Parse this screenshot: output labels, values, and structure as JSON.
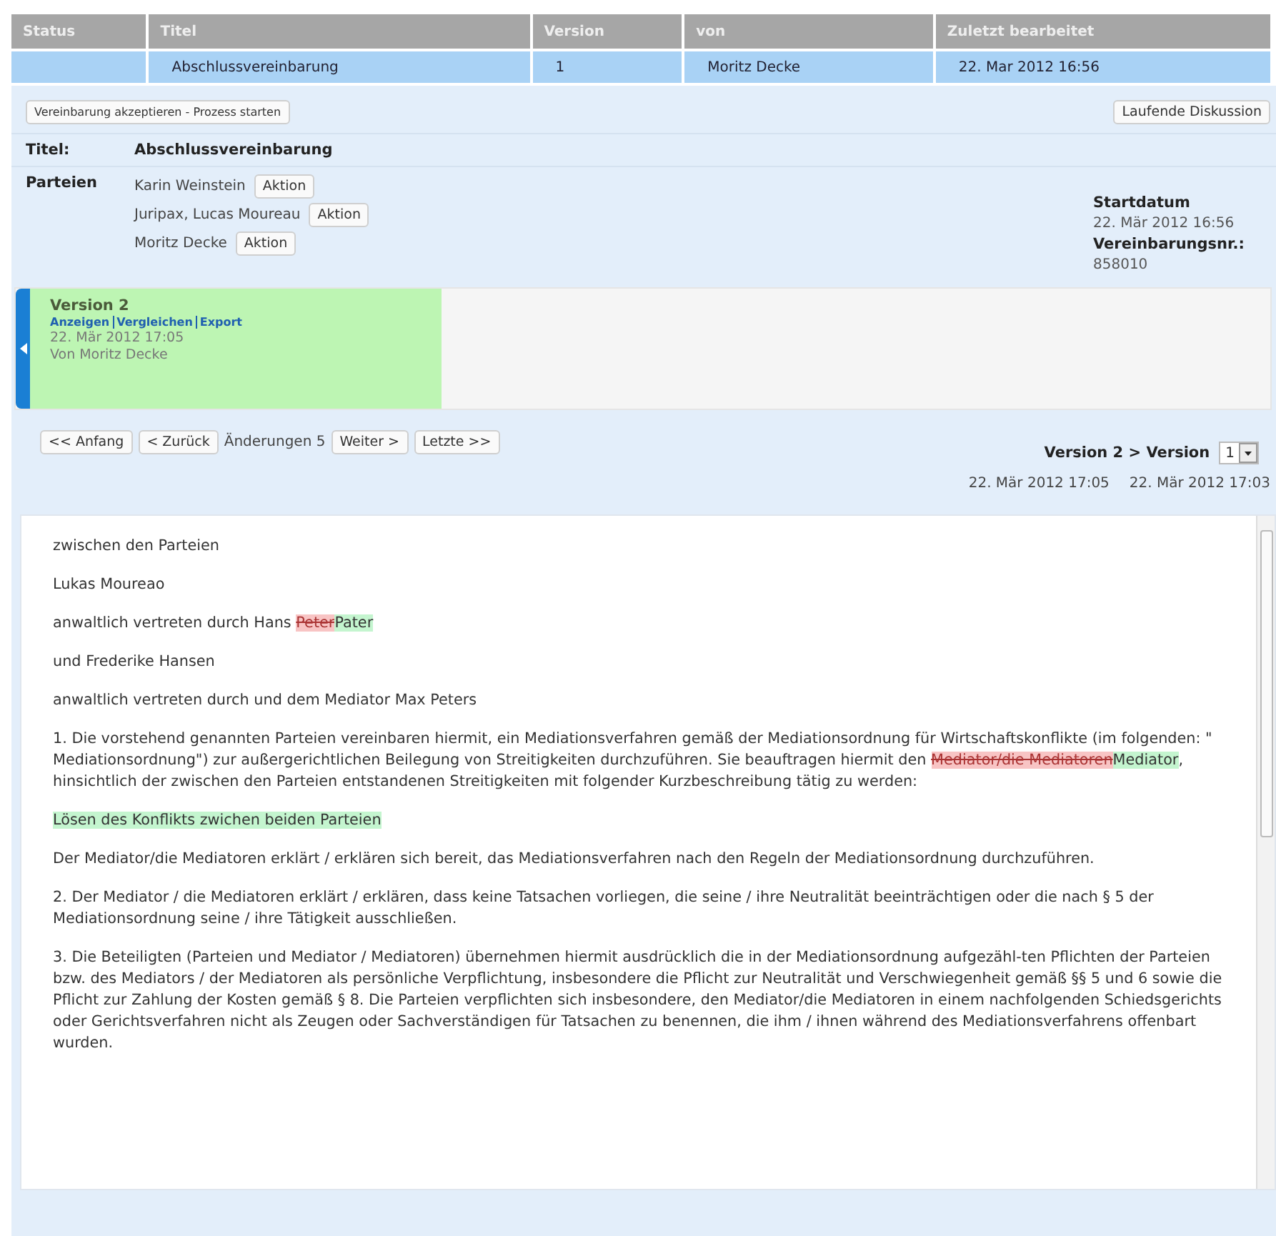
{
  "table": {
    "columns": [
      "Status",
      "Titel",
      "Version",
      "von",
      "Zuletzt bearbeitet"
    ],
    "rows": [
      {
        "selected": true,
        "cells": [
          "",
          "Abschlussvereinbarung",
          "1",
          "Moritz Decke",
          "22. Mar 2012 16:56"
        ]
      }
    ]
  },
  "actions": {
    "accept": "Vereinbarung akzeptieren - Prozess starten",
    "discussion": "Laufende Diskussion"
  },
  "title": {
    "label": "Titel:",
    "value": "Abschlussvereinbarung"
  },
  "parties": {
    "label": "Parteien",
    "items": [
      {
        "name": "Karin Weinstein",
        "action": "Aktion"
      },
      {
        "name": "Juripax, Lucas Moureau",
        "action": "Aktion"
      },
      {
        "name": "Moritz Decke",
        "action": "Aktion"
      }
    ]
  },
  "info": [
    {
      "label": "Startdatum",
      "value": "22. Mär 2012 16:56"
    },
    {
      "label": "Vereinbarungsnr.:",
      "value": "858010"
    }
  ],
  "version_card": {
    "title": "Version 2",
    "links": [
      "Anzeigen",
      "Vergleichen",
      "Export"
    ],
    "date": "22. Mär 2012 17:05",
    "author": "Von Moritz Decke"
  },
  "nav": {
    "first": "<< Anfang",
    "prev": "< Zurück",
    "changes": "Änderungen 5",
    "next": "Weiter >",
    "last": "Letzte >>"
  },
  "compare": {
    "label": "Version 2 > Version",
    "selected": "1",
    "dates": [
      "22. Mär 2012 17:05",
      "22. Mär 2012 17:03"
    ]
  },
  "document": [
    {
      "segments": [
        {
          "kind": "text",
          "text": "zwischen den Parteien"
        }
      ]
    },
    {
      "segments": [
        {
          "kind": "text",
          "text": "Lukas Moureao"
        }
      ]
    },
    {
      "segments": [
        {
          "kind": "text",
          "text": "anwaltlich vertreten durch Hans "
        },
        {
          "kind": "deleted",
          "text": "Peter"
        },
        {
          "kind": "inserted",
          "text": "Pater"
        }
      ]
    },
    {
      "segments": [
        {
          "kind": "text",
          "text": "und Frederike Hansen"
        }
      ]
    },
    {
      "segments": [
        {
          "kind": "text",
          "text": "anwaltlich vertreten durch und dem Mediator Max Peters"
        }
      ]
    },
    {
      "segments": [
        {
          "kind": "text",
          "text": "1. Die vorstehend genannten Parteien vereinbaren hiermit, ein Mediationsverfahren gemäß der Mediationsordnung für Wirtschaftskonflikte (im folgenden: \" Mediationsordnung\") zur außergerichtlichen Beilegung von Streitigkeiten durchzuführen. Sie beauftragen hiermit den "
        },
        {
          "kind": "deleted",
          "text": "Mediator/die Mediatoren"
        },
        {
          "kind": "inserted",
          "text": "Mediator"
        },
        {
          "kind": "text",
          "text": ", hinsichtlich der zwischen den Parteien entstandenen Streitigkeiten mit folgender Kurzbeschreibung tätig zu werden:"
        }
      ]
    },
    {
      "segments": [
        {
          "kind": "inserted",
          "text": "Lösen des Konflikts zwichen beiden Parteien"
        }
      ]
    },
    {
      "segments": [
        {
          "kind": "text",
          "text": "Der Mediator/die Mediatoren erklärt / erklären sich bereit, das Mediationsverfahren nach den Regeln der Mediationsordnung durchzuführen."
        }
      ]
    },
    {
      "segments": [
        {
          "kind": "text",
          "text": "2. Der Mediator / die Mediatoren erklärt / erklären, dass keine Tatsachen vorliegen, die seine / ihre Neutralität beeinträchtigen oder die nach § 5 der  Mediationsordnung seine / ihre Tätigkeit ausschließen."
        }
      ]
    },
    {
      "segments": [
        {
          "kind": "text",
          "text": "3. Die Beteiligten (Parteien und Mediator / Mediatoren) übernehmen hiermit ausdrücklich die in der Mediationsordnung aufgezähl-ten Pflichten der Parteien bzw. des Mediators / der Mediatoren als persönliche Verpflichtung, insbesondere die Pflicht zur Neutralität und Verschwiegenheit gemäß §§ 5 und 6 sowie die Pflicht zur Zahlung der Kosten gemäß § 8. Die Parteien verpflichten sich insbesondere, den Mediator/die Mediatoren in einem nachfolgenden Schiedsgerichts oder Gerichtsverfahren nicht als Zeugen oder Sachverständigen für Tatsachen zu benennen, die ihm / ihnen während des Mediationsverfahrens offenbart wurden."
        }
      ]
    }
  ]
}
